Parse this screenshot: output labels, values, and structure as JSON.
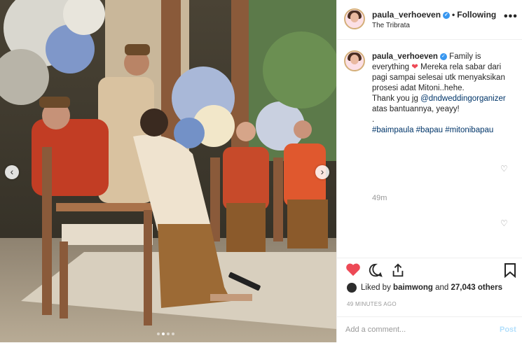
{
  "post": {
    "username": "paula_verhoeven",
    "separator": "•",
    "follow_label": "Following",
    "location": "The Tribrata",
    "more_label": "•••"
  },
  "caption": {
    "username": "paula_verhoeven",
    "text_1": "Family is everything",
    "text_2": "Mereka rela sabar dari pagi sampai selesai utk menyaksikan prosesi adat Mitoni..hehe.",
    "text_3": "Thank you jg",
    "mention": "@dndweddingorganizer",
    "text_4": "atas bantuannya, yeayy!",
    "dot": ".",
    "hashtags": "#baimpaula #bapau #mitonibapau",
    "time": "49m"
  },
  "likes": {
    "prefix": "Liked by",
    "user": "baimwong",
    "connector": "and",
    "count": "27,043 others"
  },
  "posted_ago": "49 MINUTES AGO",
  "comment_box": {
    "placeholder": "Add a comment...",
    "post_label": "Post"
  },
  "carousel": {
    "slide_count": 4,
    "active_index": 1
  },
  "colors": {
    "like_red": "#ed4956",
    "verified_blue": "#3897f0",
    "link_navy": "#003569"
  }
}
